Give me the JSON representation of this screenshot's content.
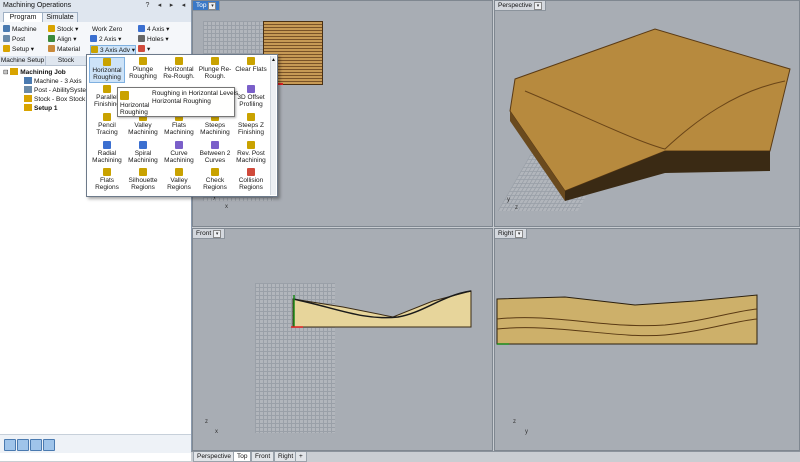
{
  "window": {
    "title": "Machining Operations",
    "buttons": [
      "?",
      "◂",
      "▸",
      "◂"
    ]
  },
  "tabs": [
    {
      "label": "Program",
      "active": true
    },
    {
      "label": "Simulate",
      "active": false
    }
  ],
  "ribbon": {
    "machine": "Machine",
    "post": "Post",
    "setup": "Setup",
    "stock": "Stock",
    "align": "Align",
    "material": "Material",
    "work_zero": "Work Zero",
    "axis2": "2 Axis",
    "axis3adv": "3 Axis Adv",
    "axis4": "4 Axis",
    "holes": "Holes"
  },
  "groups": [
    "Machine Setup",
    "Stock"
  ],
  "tree": [
    {
      "label": "Machining Job",
      "bold": true
    },
    {
      "label": "Machine - 3 Axis",
      "bold": false
    },
    {
      "label": "Post - AbilitySystem",
      "bold": false
    },
    {
      "label": "Stock - Box Stock",
      "bold": false
    },
    {
      "label": "Setup 1",
      "bold": true
    }
  ],
  "menu": [
    {
      "label": "Horizontal Roughing",
      "icon": "horizontal-roughing-icon",
      "color": "#c9a200"
    },
    {
      "label": "Plunge Roughing",
      "icon": "plunge-roughing-icon",
      "color": "#c9a200"
    },
    {
      "label": "Horizontal Re-Rough.",
      "icon": "horizontal-rerough-icon",
      "color": "#c9a200"
    },
    {
      "label": "Plunge Re-Rough.",
      "icon": "plunge-rerough-icon",
      "color": "#c9a200"
    },
    {
      "label": "Clear Flats",
      "icon": "clear-flats-icon",
      "color": "#c9a200"
    },
    {
      "label": "Parallel Finishing",
      "icon": "parallel-finishing-icon",
      "color": "#c9a200"
    },
    {
      "label": "",
      "icon": "",
      "color": ""
    },
    {
      "label": "",
      "icon": "",
      "color": ""
    },
    {
      "label": "",
      "icon": "",
      "color": ""
    },
    {
      "label": "3D Offset Profiling",
      "icon": "3d-offset-icon",
      "color": "#7a5fc9"
    },
    {
      "label": "Pencil Tracing",
      "icon": "pencil-tracing-icon",
      "color": "#c9a200"
    },
    {
      "label": "Valley Machining",
      "icon": "valley-machining-icon",
      "color": "#c9a200"
    },
    {
      "label": "Flats Machining",
      "icon": "flats-machining-icon",
      "color": "#c9a200"
    },
    {
      "label": "Steeps Machining",
      "icon": "steeps-machining-icon",
      "color": "#c9a200"
    },
    {
      "label": "Steeps Z Finishing",
      "icon": "steeps-z-icon",
      "color": "#c9a200"
    },
    {
      "label": "Radial Machining",
      "icon": "radial-machining-icon",
      "color": "#3b6fd0"
    },
    {
      "label": "Spiral Machining",
      "icon": "spiral-machining-icon",
      "color": "#3b6fd0"
    },
    {
      "label": "Curve Machining",
      "icon": "curve-machining-icon",
      "color": "#7a5fc9"
    },
    {
      "label": "Between 2 Curves",
      "icon": "between-curves-icon",
      "color": "#7a5fc9"
    },
    {
      "label": "Rev. Post Machining",
      "icon": "rev-post-icon",
      "color": "#c9a200"
    },
    {
      "label": "Flats Regions",
      "icon": "flats-regions-icon",
      "color": "#c9a200"
    },
    {
      "label": "Silhouette Regions",
      "icon": "silhouette-regions-icon",
      "color": "#c9a200"
    },
    {
      "label": "Valley Regions",
      "icon": "valley-regions-icon",
      "color": "#c9a200"
    },
    {
      "label": "Check Regions",
      "icon": "check-regions-icon",
      "color": "#c9a200"
    },
    {
      "label": "Collision Regions",
      "icon": "collision-regions-icon",
      "color": "#d04a3b"
    }
  ],
  "tooltip": {
    "title": "Roughing in Horizontal Levels",
    "subtitle": "Horizontal Roughing",
    "label": "Horizontal Roughing"
  },
  "viewports": {
    "top": "Top",
    "perspective": "Perspective",
    "front": "Front",
    "right": "Right"
  },
  "axes": {
    "x": "x",
    "y": "y",
    "z": "z"
  },
  "bottom_tabs": [
    {
      "label": "Perspective",
      "active": false
    },
    {
      "label": "Top",
      "active": true
    },
    {
      "label": "Front",
      "active": false
    },
    {
      "label": "Right",
      "active": false
    },
    {
      "label": "+",
      "active": false
    }
  ]
}
